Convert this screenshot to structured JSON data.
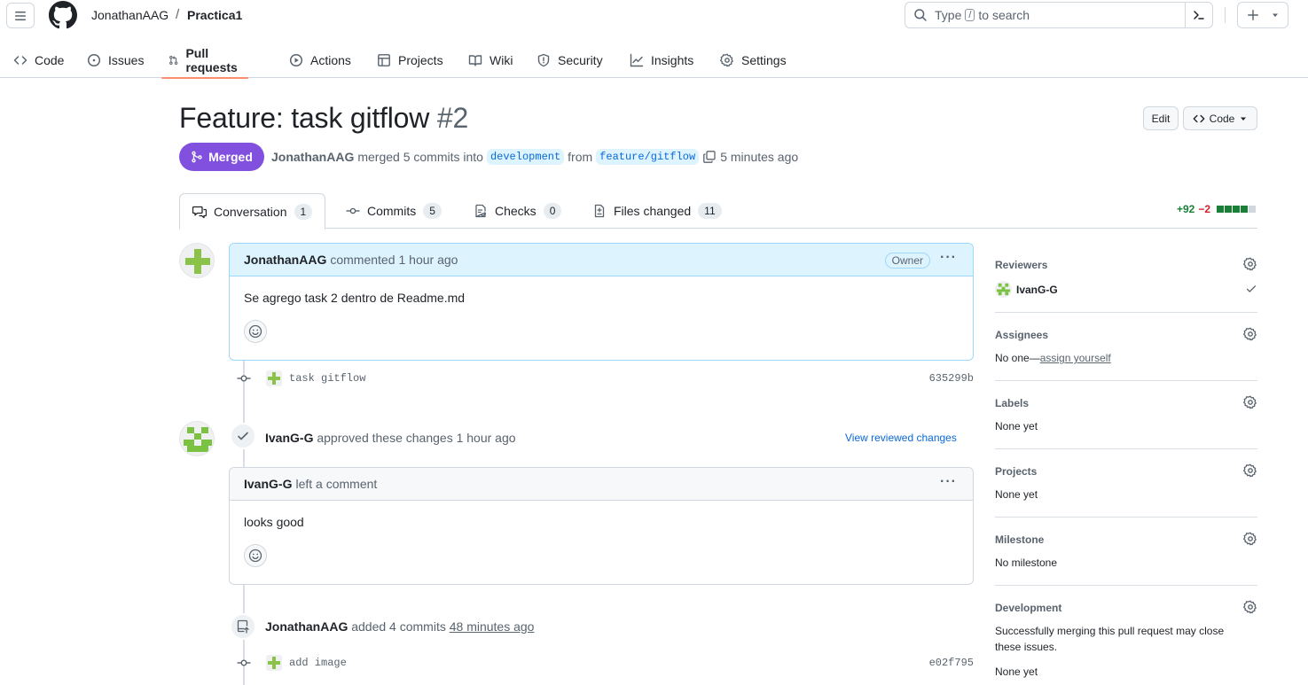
{
  "header": {
    "owner": "JonathanAAG",
    "separator": "/",
    "repo": "Practica1",
    "search_before": "Type",
    "search_key": "/",
    "search_after": "to search"
  },
  "nav": {
    "tabs": [
      {
        "label": "Code",
        "icon": "code-icon"
      },
      {
        "label": "Issues",
        "icon": "issue-icon"
      },
      {
        "label": "Pull requests",
        "icon": "pull-request-icon",
        "active": true
      },
      {
        "label": "Actions",
        "icon": "play-icon"
      },
      {
        "label": "Projects",
        "icon": "table-icon"
      },
      {
        "label": "Wiki",
        "icon": "book-icon"
      },
      {
        "label": "Security",
        "icon": "shield-icon"
      },
      {
        "label": "Insights",
        "icon": "graph-icon"
      },
      {
        "label": "Settings",
        "icon": "gear-icon"
      }
    ],
    "active_underline_color": "#fd8c73"
  },
  "pr": {
    "title": "Feature: task gitflow",
    "number": "#2",
    "edit_label": "Edit",
    "code_label": "Code",
    "state_label": "Merged",
    "state_color": "#8250df",
    "author": "JonathanAAG",
    "merged_text": "merged 5 commits into",
    "base_branch": "development",
    "from_text": "from",
    "head_branch": "feature/gitflow",
    "time": "5 minutes ago"
  },
  "pr_tabs": [
    {
      "label": "Conversation",
      "count": "1",
      "icon": "comment-discussion-icon"
    },
    {
      "label": "Commits",
      "count": "5",
      "icon": "commit-icon"
    },
    {
      "label": "Checks",
      "count": "0",
      "icon": "checklist-icon"
    },
    {
      "label": "Files changed",
      "count": "11",
      "icon": "file-diff-icon"
    }
  ],
  "diffstat": {
    "additions": "+92",
    "deletions": "−2",
    "add_color": "#1a7f37",
    "del_color": "#cf222e"
  },
  "timeline": {
    "comment1": {
      "author": "JonathanAAG",
      "action": "commented",
      "time": "1 hour ago",
      "badge": "Owner",
      "body": "Se agrego task 2 dentro de Readme.md"
    },
    "commit1": {
      "message": "task gitflow",
      "sha": "635299b"
    },
    "review": {
      "author": "IvanG-G",
      "action": "approved these changes",
      "time": "1 hour ago",
      "link": "View reviewed changes"
    },
    "comment2": {
      "author": "IvanG-G",
      "action": "left a comment",
      "body": "looks good"
    },
    "push": {
      "author": "JonathanAAG",
      "action": "added 4 commits",
      "time": "48 minutes ago"
    },
    "commit2": {
      "message": "add image",
      "sha": "e02f795"
    }
  },
  "sidebar": {
    "reviewers": {
      "title": "Reviewers",
      "name": "IvanG-G"
    },
    "assignees": {
      "title": "Assignees",
      "prefix": "No one—",
      "link": "assign yourself"
    },
    "labels": {
      "title": "Labels",
      "value": "None yet"
    },
    "projects": {
      "title": "Projects",
      "value": "None yet"
    },
    "milestone": {
      "title": "Milestone",
      "value": "No milestone"
    },
    "development": {
      "title": "Development",
      "line1": "Successfully merging this pull request may close",
      "line2": "these issues.",
      "value": "None yet"
    }
  }
}
